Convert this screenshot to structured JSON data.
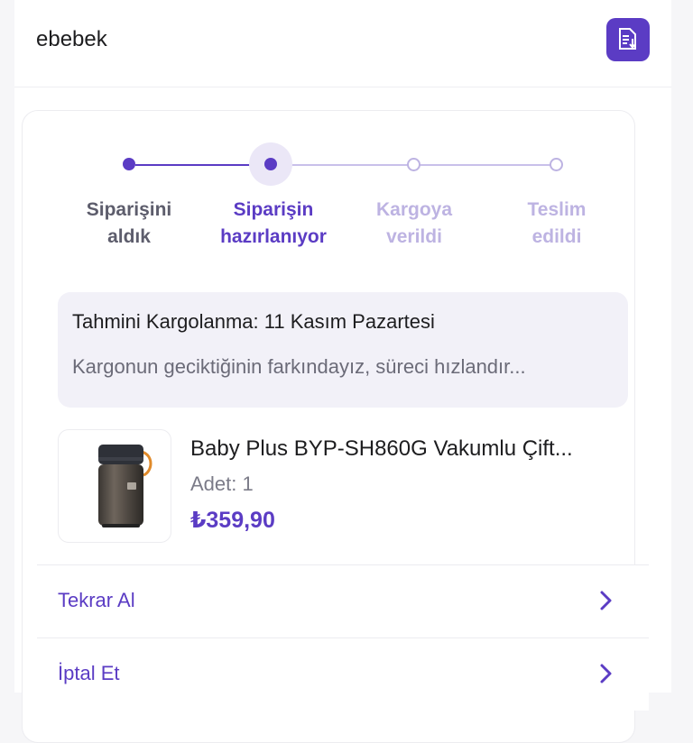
{
  "header": {
    "store_name": "ebebek",
    "doc_icon": "document-icon",
    "accent": "#5b3cc4"
  },
  "stepper": {
    "current_step": 2,
    "steps": [
      {
        "line1": "Siparişini",
        "line2": "aldık",
        "state": "done"
      },
      {
        "line1": "Siparişin",
        "line2": "hazırlanıyor",
        "state": "active"
      },
      {
        "line1": "Kargoya",
        "line2": "verildi",
        "state": "pending"
      },
      {
        "line1": "Teslim",
        "line2": "edildi",
        "state": "pending"
      }
    ]
  },
  "shipping": {
    "estimate": "Tahmini Kargolanma: 11 Kasım Pazartesi",
    "notice": "Kargonun geciktiğinin farkındayız, süreci hızlandır..."
  },
  "product": {
    "name": "Baby Plus BYP-SH860G Vakumlu Çift...",
    "quantity": "Adet: 1",
    "price": "₺359,90",
    "image_icon": "thermos-image"
  },
  "actions": [
    {
      "label": "Tekrar Al",
      "icon": "chevron-right-icon"
    },
    {
      "label": "İptal Et",
      "icon": "chevron-right-icon"
    }
  ],
  "colors": {
    "accent": "#5b3cc4",
    "done_text": "#5d5d6c",
    "pending": "#bdb3e2",
    "eta_bg": "#f2f1f8"
  }
}
